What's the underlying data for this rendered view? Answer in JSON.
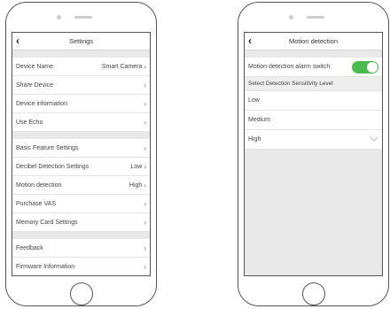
{
  "settings": {
    "title": "Settings",
    "groups": [
      [
        {
          "label": "Device Name",
          "value": "Smart Camera"
        },
        {
          "label": "Share Device",
          "value": ""
        },
        {
          "label": "Device information",
          "value": ""
        },
        {
          "label": "Use Echo",
          "value": ""
        }
      ],
      [
        {
          "label": "Basic Feature Settings",
          "value": ""
        },
        {
          "label": "Decibel Detection Settings",
          "value": "Low"
        },
        {
          "label": "Motion detection",
          "value": "High"
        },
        {
          "label": "Purchase VAS",
          "value": ""
        },
        {
          "label": "Memory Card Settings",
          "value": ""
        }
      ],
      [
        {
          "label": "Feedback",
          "value": ""
        },
        {
          "label": "Firmware Information",
          "value": ""
        }
      ]
    ]
  },
  "motion": {
    "title": "Motion detection",
    "alarm_switch_label": "Motion detection alarm switch",
    "alarm_switch_on": true,
    "sensitivity_title": "Select Detection Sensitivity Level",
    "levels": [
      "Low",
      "Medium",
      "High"
    ],
    "selected_level": "High"
  },
  "icons": {
    "back": "chevron-left-icon",
    "row_arrow": "chevron-right-icon",
    "selected_check": "check-icon"
  },
  "colors": {
    "toggle_on": "#4cbb4f"
  }
}
